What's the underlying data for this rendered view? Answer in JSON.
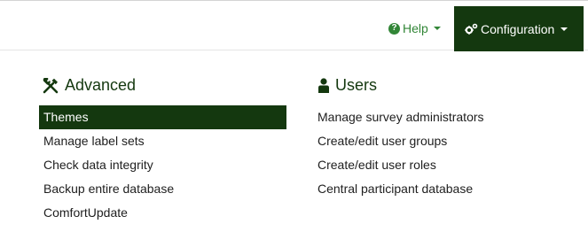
{
  "topbar": {
    "help_label": "Help",
    "help_icon": "question-circle-icon",
    "config_label": "Configuration",
    "config_icon": "gears-icon",
    "accent_color": "#14380f",
    "help_color": "#328637"
  },
  "advanced": {
    "title": "Advanced",
    "icon": "tools-icon",
    "items": [
      {
        "label": "Themes",
        "active": true
      },
      {
        "label": "Manage label sets"
      },
      {
        "label": "Check data integrity"
      },
      {
        "label": "Backup entire database"
      },
      {
        "label": "ComfortUpdate"
      }
    ]
  },
  "users": {
    "title": "Users",
    "icon": "user-icon",
    "items": [
      {
        "label": "Manage survey administrators"
      },
      {
        "label": "Create/edit user groups"
      },
      {
        "label": "Create/edit user roles"
      },
      {
        "label": "Central participant database"
      }
    ]
  }
}
